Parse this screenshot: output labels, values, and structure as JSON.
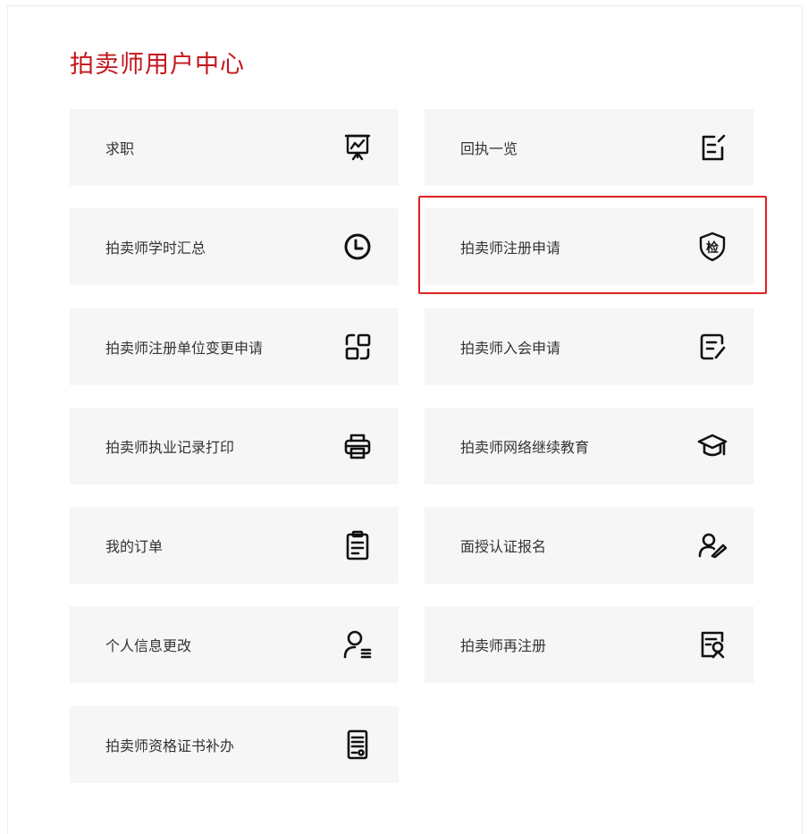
{
  "page": {
    "title": "拍卖师用户中心"
  },
  "colors": {
    "accent": "#c4161c",
    "highlight_border": "#e02020",
    "tile_bg": "#f6f6f6"
  },
  "tiles": [
    {
      "label": "求职",
      "icon": "presentation-chart-icon"
    },
    {
      "label": "回执一览",
      "icon": "edit-document-icon"
    },
    {
      "label": "拍卖师学时汇总",
      "icon": "clock-icon"
    },
    {
      "label": "拍卖师注册申请",
      "icon": "inspection-shield-icon",
      "highlighted": true
    },
    {
      "label": "拍卖师注册单位变更申请",
      "icon": "switch-frames-icon"
    },
    {
      "label": "拍卖师入会申请",
      "icon": "form-pen-icon"
    },
    {
      "label": "拍卖师执业记录打印",
      "icon": "printer-icon"
    },
    {
      "label": "拍卖师网络继续教育",
      "icon": "graduation-cap-icon"
    },
    {
      "label": "我的订单",
      "icon": "clipboard-icon"
    },
    {
      "label": "面授认证报名",
      "icon": "user-sign-icon"
    },
    {
      "label": "个人信息更改",
      "icon": "user-list-icon"
    },
    {
      "label": "拍卖师再注册",
      "icon": "document-search-icon"
    },
    {
      "label": "拍卖师资格证书补办",
      "icon": "certificate-icon"
    }
  ],
  "icon_glyphs": {
    "inspection_badge": "检"
  }
}
